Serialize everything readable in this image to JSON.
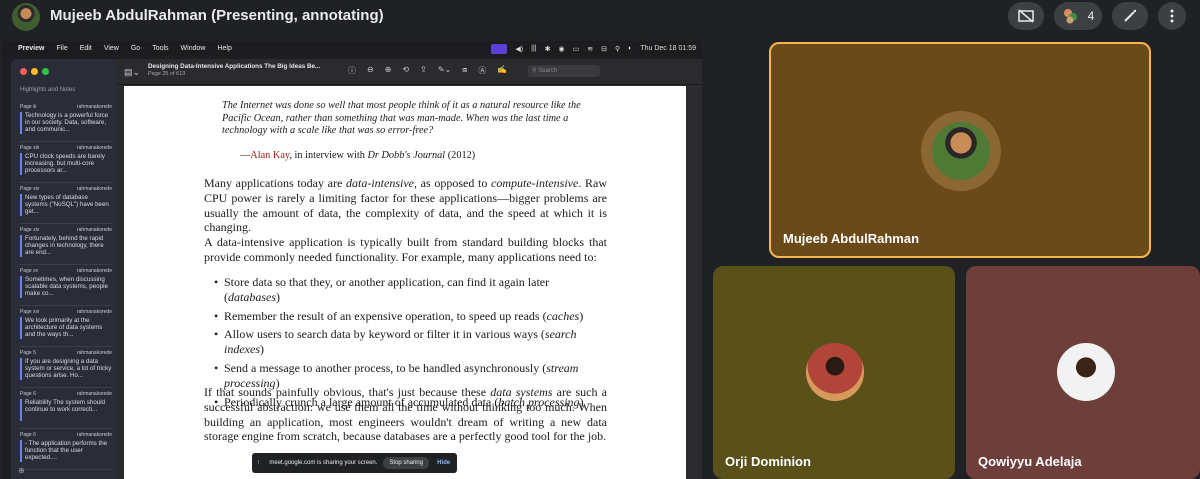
{
  "meet": {
    "presenter_title": "Mujeeb AbdulRahman (Presenting, annotating)",
    "people_count": "4",
    "controls": [
      "present-off-icon",
      "people-icon",
      "annotate-icon",
      "more-icon"
    ]
  },
  "mac": {
    "app_name": "Preview",
    "menus": [
      "File",
      "Edit",
      "View",
      "Go",
      "Tools",
      "Window",
      "Help"
    ],
    "datetime": "Thu Dec 18  01:59"
  },
  "sidebar": {
    "header": "Highlights and Notes",
    "notes": [
      {
        "page": "Page iii",
        "author": "rahmanakorede",
        "text": "Technology is a powerful force in our society. Data, software, and communic..."
      },
      {
        "page": "Page xiii",
        "author": "rahmanakorede",
        "text": "CPU clock speeds are barely increasing, but multi-core processors ar..."
      },
      {
        "page": "Page xiv",
        "author": "rahmanakorede",
        "text": "New types of database systems (\"NoSQL\") have been get..."
      },
      {
        "page": "Page xiv",
        "author": "rahmanakorede",
        "text": "Fortunately, behind the rapid changes in technology, there are end..."
      },
      {
        "page": "Page xv",
        "author": "rahmanakorede",
        "text": "Sometimes, when discussing scalable data systems, people make co..."
      },
      {
        "page": "Page xvi",
        "author": "rahmanakorede",
        "text": "We look primarily at the architecture of data systems and the ways th..."
      },
      {
        "page": "Page 5",
        "author": "rahmanakorede",
        "text": "If you are designing a data system or service, a lot of tricky questions arise. Ho..."
      },
      {
        "page": "Page 6",
        "author": "rahmanakorede",
        "text": "Reliability The system should continue to work correcti..."
      },
      {
        "page": "Page 6",
        "author": "rahmanakorede",
        "text": "- The application performs the function that the user expected...."
      }
    ]
  },
  "preview": {
    "doc_title": "Designing Data-Intensive Applications The Big Ideas Be...",
    "page_indicator": "Page 25 of 613",
    "search_placeholder": "Search"
  },
  "page": {
    "quote": "The Internet was done so well that most people think of it as a natural resource like the Pacific Ocean, rather than something that was man-made. When was the last time a technology with a scale like that was so error-free?",
    "attr_dash": "—",
    "attr_name": "Alan Kay",
    "attr_mid": ", in interview with ",
    "attr_journal": "Dr Dobb's Journal",
    "attr_year": " (2012)",
    "p1_a": "Many applications today are ",
    "p1_b": "data-intensive",
    "p1_c": ", as opposed to ",
    "p1_d": "compute-intensive",
    "p1_e": ". Raw CPU power is rarely a limiting factor for these applications—bigger problems are usually the amount of data, the complexity of data, and the speed at which it is changing.",
    "p2": "A data-intensive application is typically built from standard building blocks that provide commonly needed functionality. For example, many applications need to:",
    "bullets": [
      {
        "text": "Store data so that they, or another application, can find it again later (",
        "em": "databases",
        "end": ")"
      },
      {
        "text": "Remember the result of an expensive operation, to speed up reads (",
        "em": "caches",
        "end": ")"
      },
      {
        "text": "Allow users to search data by keyword or filter it in various ways (",
        "em": "search indexes",
        "end": ")"
      },
      {
        "text": "Send a message to another process, to be handled asynchronously (",
        "em": "stream processing",
        "end": ")"
      },
      {
        "text": "Periodically crunch a large amount of accumulated data (",
        "em": "batch processing",
        "end": ")"
      }
    ],
    "p3_a": "If that sounds painfully obvious, that's just because these ",
    "p3_b": "data systems",
    "p3_c": " are such a successful abstraction: we use them all the time without thinking too much. When building an application, most engineers wouldn't dream of writing a new data storage engine from scratch, because databases are a perfectly good tool for the job."
  },
  "share_bar": {
    "text": "meet.google.com is sharing your screen.",
    "stop_label": "Stop sharing",
    "hide_label": "Hide"
  },
  "participants": [
    {
      "name": "Mujeeb AbdulRahman",
      "active_speaker": true
    },
    {
      "name": "Orji Dominion"
    },
    {
      "name": "Qowiyyu Adelaja"
    }
  ],
  "colors": {
    "meet_bg": "#202124",
    "speaker_border": "#f6b54e",
    "link_blue": "#8ab4f8",
    "note_accent": "#6a80ff",
    "quote_name_red": "#a0251d"
  }
}
